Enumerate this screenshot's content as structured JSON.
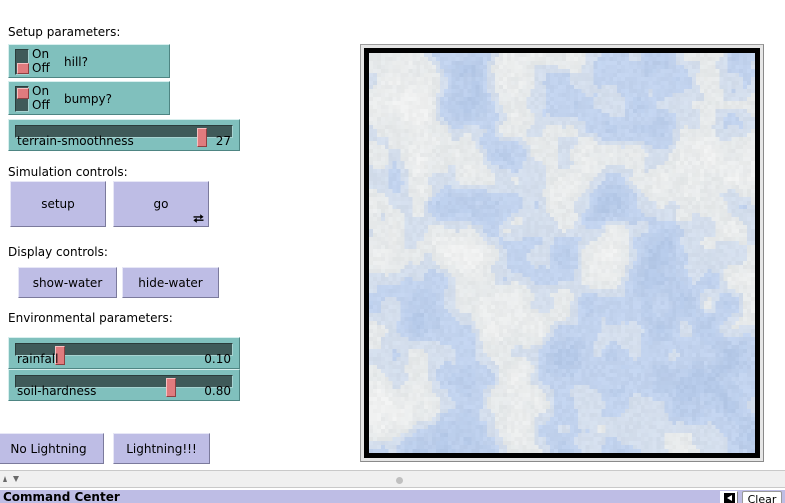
{
  "app": {
    "model_type": "netlogo-interface"
  },
  "sections": {
    "setup_parameters_label": "Setup parameters:",
    "simulation_controls_label": "Simulation controls:",
    "display_controls_label": "Display controls:",
    "environmental_parameters_label": "Environmental parameters:"
  },
  "switches": [
    {
      "name": "hill?",
      "on_label": "On",
      "off_label": "Off",
      "value": "Off"
    },
    {
      "name": "bumpy?",
      "on_label": "On",
      "off_label": "Off",
      "value": "On"
    }
  ],
  "setup_sliders": [
    {
      "name": "terrain-smoothness",
      "value": "27",
      "percent": 88
    }
  ],
  "environmental_sliders": [
    {
      "name": "rainfall",
      "value": "0.10",
      "percent": 19
    },
    {
      "name": "soil-hardness",
      "value": "0.80",
      "percent": 73
    }
  ],
  "buttons": {
    "setup": "setup",
    "go": "go",
    "go_forever_icon": "loop-forever-icon",
    "show_water": "show-water",
    "hide_water": "hide-water",
    "no_lightning": "No Lightning",
    "lightning": "Lightning!!!"
  },
  "command_center": {
    "title": "Command Center",
    "clear_label": "Clear",
    "toggle_icon": "arrow-toggle-icon"
  },
  "splitter": {
    "up_arrow_icon": "triangle-up-icon",
    "down_arrow_icon": "triangle-down-icon",
    "grip_icon": "drag-grip-icon"
  },
  "world_view": {
    "name": "world-view",
    "background_color": "#000000",
    "patch_colors": [
      "#c2d3ee",
      "#d4dff1",
      "#e6e9ea",
      "#eff0f0",
      "#b5c9e8"
    ],
    "frame_color": "#e6e6e6"
  },
  "colors": {
    "widget_teal": "#80c0bd",
    "button_lavender": "#bebde5",
    "knob_red": "#e07b7e",
    "track_dark": "#3f5a59"
  }
}
